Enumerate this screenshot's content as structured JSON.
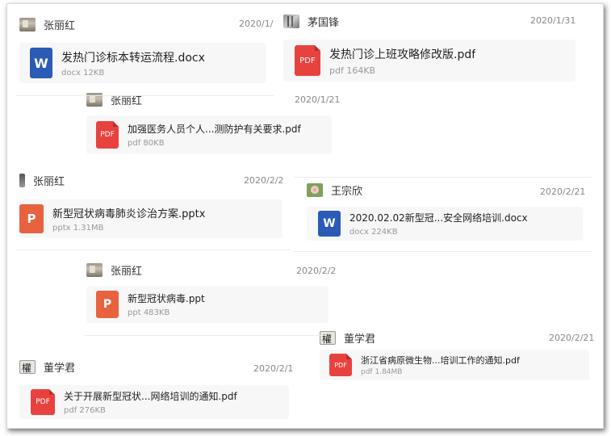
{
  "messages": [
    {
      "sender": "张丽红",
      "date": "2020/1/",
      "avatar": "landscape-photo",
      "file": {
        "name": "发热门诊标本转运流程.docx",
        "type": "docx",
        "size": "12KB",
        "icon": "word-icon",
        "icon_label": "W"
      }
    },
    {
      "sender": "茅国锋",
      "date": "2020/1/31",
      "avatar": "grey-photo",
      "file": {
        "name": "发热门诊上班攻略修改版.pdf",
        "type": "pdf",
        "size": "164KB",
        "icon": "pdf-icon",
        "icon_label": "PDF"
      }
    },
    {
      "sender": "张丽红",
      "date": "2020/1/21",
      "avatar": "landscape-photo",
      "file": {
        "name": "加强医务人员个人...测防护有关要求.pdf",
        "type": "pdf",
        "size": "80KB",
        "icon": "pdf-icon",
        "icon_label": "PDF"
      }
    },
    {
      "sender": "张丽红",
      "date": "2020/2/2",
      "avatar": "thin-photo",
      "file": {
        "name": "新型冠状病毒肺炎诊治方案.pptx",
        "type": "pptx",
        "size": "1.31MB",
        "icon": "powerpoint-icon",
        "icon_label": "P"
      }
    },
    {
      "sender": "王宗欣",
      "date": "2020/2/21",
      "avatar": "flower-photo",
      "file": {
        "name": "2020.02.02新型冠...安全网络培训.docx",
        "type": "docx",
        "size": "224KB",
        "icon": "word-icon",
        "icon_label": "W"
      }
    },
    {
      "sender": "张丽红",
      "date": "2020/2/2",
      "avatar": "landscape-photo",
      "file": {
        "name": "新型冠状病毒.ppt",
        "type": "ppt",
        "size": "483KB",
        "icon": "powerpoint-icon",
        "icon_label": "P"
      }
    },
    {
      "sender": "董学君",
      "date": "2020/2/21",
      "avatar": "calligraphy",
      "file": {
        "name": "浙江省病原微生物...培训工作的通知.pdf",
        "type": "pdf",
        "size": "1.84MB",
        "icon": "pdf-icon",
        "icon_label": "PDF"
      }
    },
    {
      "sender": "董学君",
      "date": "2020/2/1",
      "avatar": "calligraphy",
      "file": {
        "name": "关于开展新型冠状...网络培训的通知.pdf",
        "type": "pdf",
        "size": "276KB",
        "icon": "pdf-icon",
        "icon_label": "PDF"
      }
    }
  ],
  "colors": {
    "word": "#2b5bb5",
    "pdf": "#e8423f",
    "ppt": "#e8623f",
    "card": "#f7f7f7"
  }
}
